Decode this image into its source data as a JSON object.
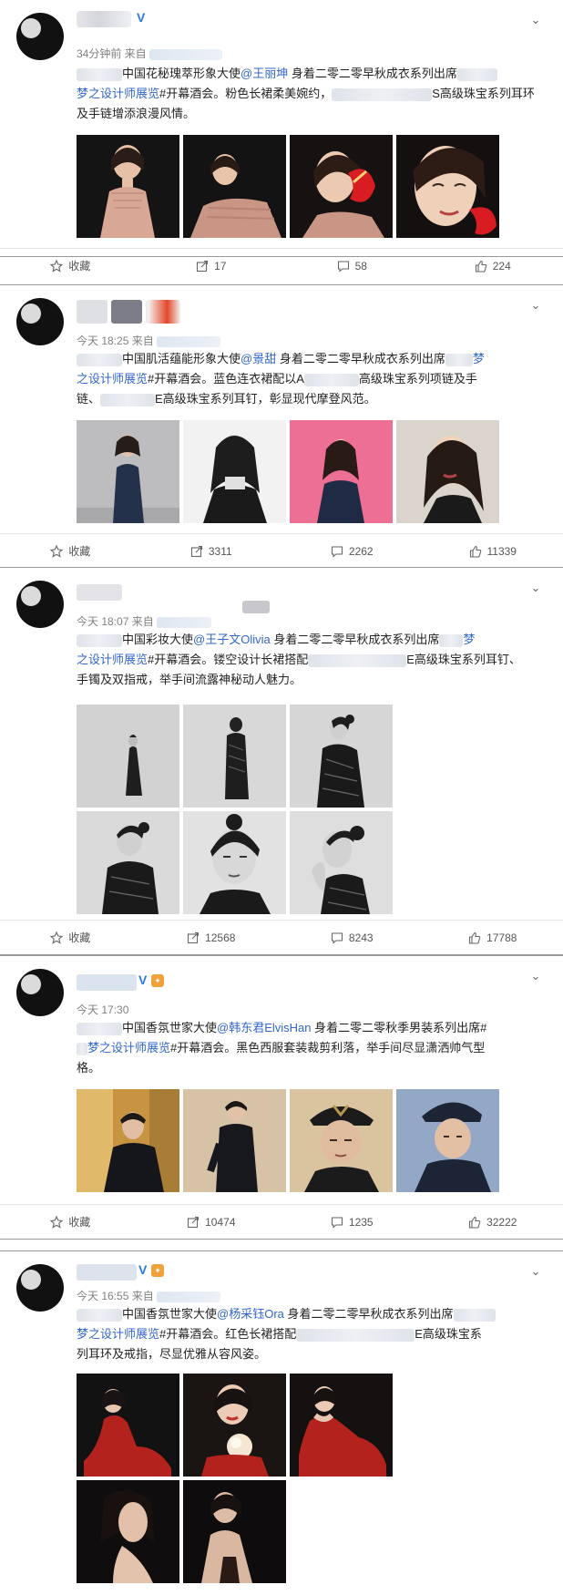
{
  "posts": [
    {
      "time": "34分钟前 来自",
      "text_a": "中国花秘瑰萃形象大使",
      "mention": "@王丽坤",
      "text_b": " 身着二零二零早秋成衣系列出席",
      "text_c": "梦之设计师展览",
      "text_d": "#开幕酒会。粉色长裙柔美婉约，",
      "text_e": "S高级珠宝系列耳环及手链增添浪漫风情。",
      "actions": {
        "fav": "收藏",
        "repost": "17",
        "comment": "58",
        "like": "224"
      }
    },
    {
      "time": "今天 18:25 来自",
      "text_a": "中国肌活蕴能形象大使",
      "mention": "@景甜",
      "text_b": " 身着二零二零早秋成衣系列出席",
      "link_tail": "梦",
      "text_c": "之设计师展览",
      "text_d": "#开幕酒会。蓝色连衣裙配以A",
      "text_e": "高级珠宝系列项链及手",
      "text_f": "链、",
      "text_g": "E高级珠宝系列耳钉，彰显现代摩登风范。",
      "actions": {
        "fav": "收藏",
        "repost": "3311",
        "comment": "2262",
        "like": "11339"
      }
    },
    {
      "time": "今天 18:07 来自",
      "text_a": "中国彩妆大使",
      "mention": "@王子文Olivia",
      "text_b": " 身着二零二零早秋成衣系列出席",
      "link_tail": "梦",
      "text_c": "之设计师展览",
      "text_d": "#开幕酒会。镂空设计长裙搭配",
      "text_e": "E高级珠宝系列耳钉、",
      "text_f": "手镯及双指戒，举手间流露神秘动人魅力。",
      "actions": {
        "fav": "收藏",
        "repost": "12568",
        "comment": "8243",
        "like": "17788"
      }
    },
    {
      "time": "今天 17:30",
      "text_a": "中国香氛世家大使",
      "mention": "@韩东君ElvisHan",
      "text_b": " 身着二零二零秋季男装系列出席#",
      "text_c": "梦之设计师展览",
      "text_d": "#开幕酒会。黑色西服套装裁剪利落，举手间尽显潇洒帅气型",
      "text_e": "格。",
      "actions": {
        "fav": "收藏",
        "repost": "10474",
        "comment": "1235",
        "like": "32222"
      }
    },
    {
      "time": "今天 16:55 来自",
      "text_a": "中国香氛世家大使",
      "mention": "@杨采钰Ora",
      "text_b": " 身着二零二零早秋成衣系列出席",
      "text_c": "梦之设计师展览",
      "text_d": "#开幕酒会。红色长裙搭配",
      "text_e": "E高级珠宝系",
      "text_f": "列耳环及戒指，尽显优雅从容风姿。"
    }
  ],
  "colors": {
    "link": "#3366cc",
    "meta": "#808080",
    "verified": "#2a7ae2",
    "badge": "#f0a13a"
  },
  "icons": [
    "star-icon",
    "repost-icon",
    "comment-icon",
    "like-icon",
    "chevron-down-icon",
    "verified-icon"
  ]
}
